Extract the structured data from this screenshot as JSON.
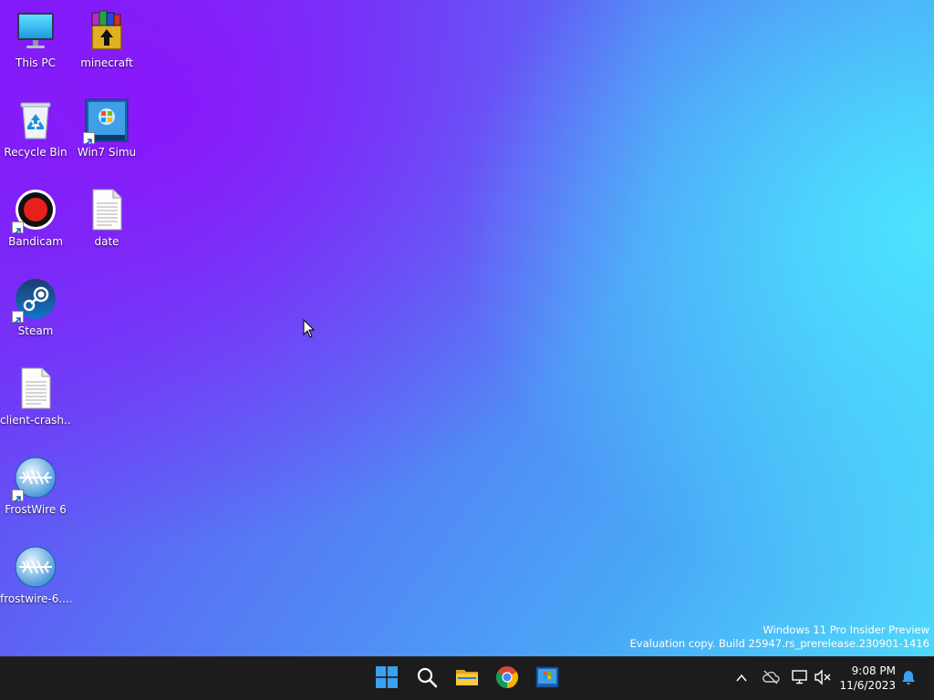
{
  "desktop": {
    "icons": [
      {
        "label": "This PC",
        "icon": "monitor-icon"
      },
      {
        "label": "minecraft",
        "icon": "winrar-archive-icon"
      },
      {
        "label": "Recycle Bin",
        "icon": "recycle-bin-icon"
      },
      {
        "label": "Win7 Simu",
        "icon": "win7-simulator-icon",
        "shortcut": true
      },
      {
        "label": "Bandicam",
        "icon": "bandicam-record-icon",
        "shortcut": true
      },
      {
        "label": "date",
        "icon": "text-document-icon"
      },
      {
        "label": "Steam",
        "icon": "steam-icon",
        "shortcut": true
      },
      {
        "label": "client-crash...",
        "icon": "text-document-icon"
      },
      {
        "label": "FrostWire 6",
        "icon": "frostwire-icon",
        "shortcut": true
      },
      {
        "label": "frostwire-6....",
        "icon": "frostwire-installer-icon"
      }
    ]
  },
  "watermark": {
    "line1": "Windows 11 Pro Insider Preview",
    "line2": "Evaluation copy. Build 25947.rs_prerelease.230901-1416"
  },
  "taskbar": {
    "pinned": [
      {
        "name": "Start",
        "icon": "windows-start-icon"
      },
      {
        "name": "Search",
        "icon": "search-icon"
      },
      {
        "name": "File Explorer",
        "icon": "folder-icon"
      },
      {
        "name": "Google Chrome",
        "icon": "chrome-icon"
      },
      {
        "name": "Win7 Simu",
        "icon": "win7-simulator-icon"
      }
    ],
    "tray": {
      "icons": [
        "chevron-up-icon",
        "onedrive-offline-icon",
        "network-icon",
        "volume-muted-icon"
      ],
      "time": "9:08 PM",
      "date": "11/6/2023",
      "notification_icon": "bell-icon"
    }
  }
}
